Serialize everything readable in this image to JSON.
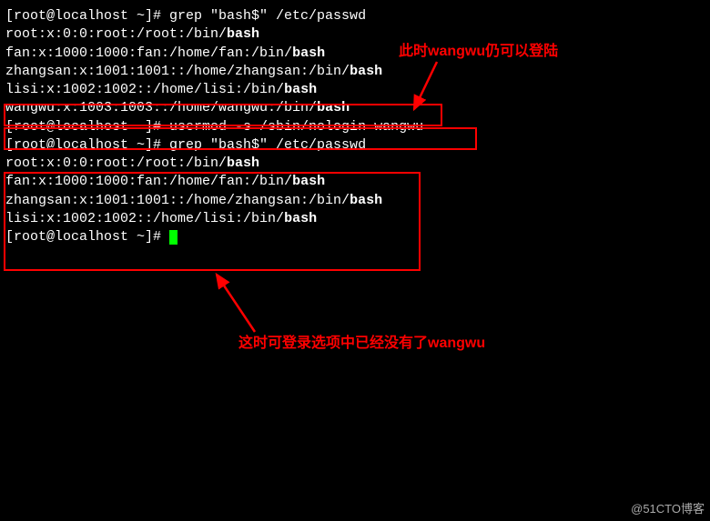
{
  "lines": {
    "l1a": "[root@localhost ~]# grep \"bash$\" /etc/passwd",
    "l2a": "root:x:0:0:root:/root:/bin/",
    "l2b": "bash",
    "l3a": "fan:x:1000:1000:fan:/home/fan:/bin/",
    "l3b": "bash",
    "l4a": "zhangsan:x:1001:1001::/home/zhangsan:/bin/",
    "l4b": "bash",
    "l5a": "lisi:x:1002:1002::/home/lisi:/bin/",
    "l5b": "bash",
    "l6a": "wangwu:x:1003:1003::/home/wangwu:/bin/",
    "l6b": "bash",
    "l7a": "[root@localhost ~]# usermod -s /sbin/nologin wangwu",
    "l8a": "[root@localhost ~]# grep \"bash$\" /etc/passwd",
    "l9a": "root:x:0:0:root:/root:/bin/",
    "l9b": "bash",
    "l10a": "fan:x:1000:1000:fan:/home/fan:/bin/",
    "l10b": "bash",
    "l11a": "zhangsan:x:1001:1001::/home/zhangsan:/bin/",
    "l11b": "bash",
    "l12a": "lisi:x:1002:1002::/home/lisi:/bin/",
    "l12b": "bash",
    "l13a": "[root@localhost ~]# "
  },
  "annotations": {
    "a1": "此时wangwu仍可以登陆",
    "a2": "这时可登录选项中已经没有了wangwu"
  },
  "watermark": "@51CTO博客"
}
